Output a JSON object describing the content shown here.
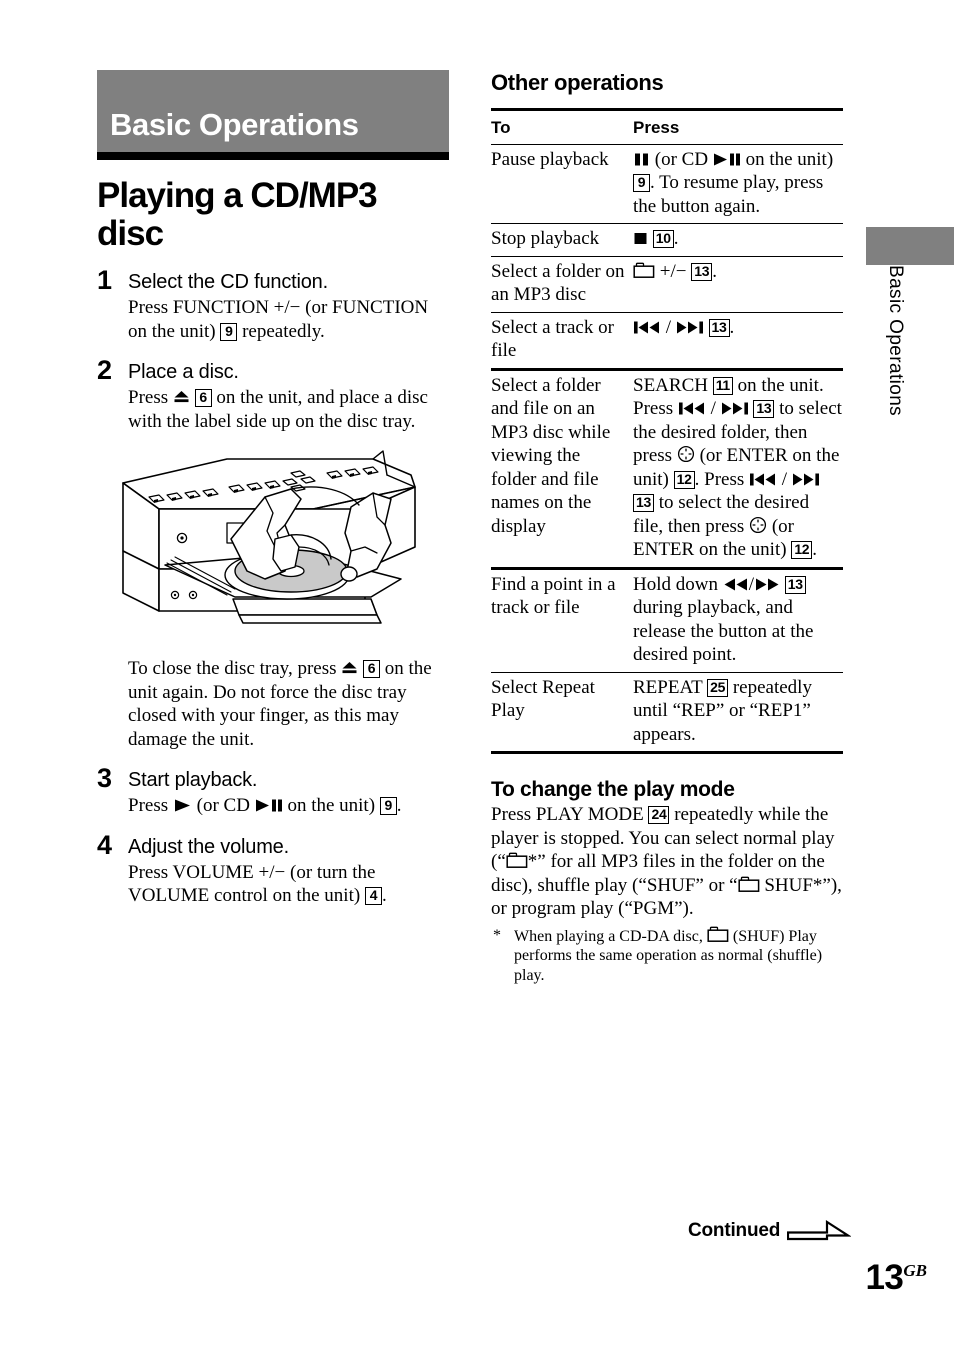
{
  "chapter": {
    "banner_label": "Basic Operations",
    "side_tab_label": "Basic Operations",
    "banner_color": "#808080"
  },
  "page_title": "Playing a CD/MP3 disc",
  "steps": [
    {
      "num": "1",
      "title": "Select the CD function.",
      "body_pre": "Press FUNCTION +/− (or FUNCTION on the unit) ",
      "ref": "9",
      "body_post": " repeatedly."
    },
    {
      "num": "2",
      "title": "Place a disc.",
      "body_pre": "Press ",
      "ref": "6",
      "body_post": " on the unit, and place a disc with the label side up on the disc tray."
    },
    {
      "num": "3",
      "title": "Start playback.",
      "body_pre": "Press ",
      "body_mid": " (or CD ",
      "ref": "9",
      "body_post": " on the unit) "
    },
    {
      "num": "4",
      "title": "Adjust the volume.",
      "body_pre": "Press VOLUME +/− (or turn the VOLUME control on the unit) ",
      "ref": "4",
      "body_post": "."
    }
  ],
  "illustration": {
    "name": "cd-player-loading-disc",
    "caption": ""
  },
  "tray_note": {
    "line1_pre": "To close the disc tray, press ",
    "line1_ref": "6",
    "line1_post": " on the unit again.",
    "line2": "Do not force the disc tray closed with your finger, as this may damage the unit."
  },
  "other_operations": {
    "heading": "Other operations",
    "columns": [
      "To",
      "Press"
    ],
    "rows": [
      {
        "to": "Pause playback",
        "press_parts": [
          {
            "type": "icon",
            "name": "pause-icon"
          },
          {
            "type": "text",
            "value": " (or CD "
          },
          {
            "type": "icon",
            "name": "play-pause-icon"
          },
          {
            "type": "text",
            "value": " on the unit) "
          },
          {
            "type": "ref",
            "value": "9"
          },
          {
            "type": "text",
            "value": ". To resume play, press the button again."
          }
        ]
      },
      {
        "to": "Stop playback",
        "press_parts": [
          {
            "type": "icon",
            "name": "stop-icon"
          },
          {
            "type": "text",
            "value": " "
          },
          {
            "type": "ref",
            "value": "10"
          },
          {
            "type": "text",
            "value": "."
          }
        ]
      },
      {
        "to": "Select a folder on an MP3 disc",
        "press_parts": [
          {
            "type": "icon",
            "name": "folder-icon"
          },
          {
            "type": "text",
            "value": " +/− "
          },
          {
            "type": "ref",
            "value": "13"
          },
          {
            "type": "text",
            "value": "."
          }
        ]
      },
      {
        "to": "Select a track or file",
        "press_parts": [
          {
            "type": "icon",
            "name": "prev-track-icon"
          },
          {
            "type": "text",
            "value": " / "
          },
          {
            "type": "icon",
            "name": "next-track-icon"
          },
          {
            "type": "text",
            "value": " "
          },
          {
            "type": "ref",
            "value": "13"
          },
          {
            "type": "text",
            "value": "."
          }
        ]
      },
      {
        "to": "Select a folder and file on an MP3 disc while viewing the folder and file names on the display",
        "press_parts": [
          {
            "type": "text",
            "value": "SEARCH "
          },
          {
            "type": "ref",
            "value": "11"
          },
          {
            "type": "text",
            "value": " on the unit. Press "
          },
          {
            "type": "icon",
            "name": "prev-track-icon"
          },
          {
            "type": "text",
            "value": " / "
          },
          {
            "type": "icon",
            "name": "next-track-icon"
          },
          {
            "type": "text",
            "value": " "
          },
          {
            "type": "ref",
            "value": "13"
          },
          {
            "type": "text",
            "value": " to select the desired folder, then press "
          },
          {
            "type": "icon",
            "name": "enter-circle-icon"
          },
          {
            "type": "text",
            "value": " (or ENTER on the unit) "
          },
          {
            "type": "ref",
            "value": "12"
          },
          {
            "type": "text",
            "value": ". Press "
          },
          {
            "type": "icon",
            "name": "prev-track-icon"
          },
          {
            "type": "text",
            "value": " / "
          },
          {
            "type": "icon",
            "name": "next-track-icon"
          },
          {
            "type": "text",
            "value": " "
          },
          {
            "type": "ref",
            "value": "13"
          },
          {
            "type": "text",
            "value": " to select the desired file, then press "
          },
          {
            "type": "icon",
            "name": "enter-circle-icon"
          },
          {
            "type": "text",
            "value": " (or ENTER on the unit) "
          },
          {
            "type": "ref",
            "value": "12"
          },
          {
            "type": "text",
            "value": "."
          }
        ]
      },
      {
        "to": "Find a point in a track or file",
        "press_parts": [
          {
            "type": "text",
            "value": "Hold down "
          },
          {
            "type": "icon",
            "name": "rewind-icon"
          },
          {
            "type": "text",
            "value": "/"
          },
          {
            "type": "icon",
            "name": "fast-forward-icon"
          },
          {
            "type": "text",
            "value": " "
          },
          {
            "type": "ref",
            "value": "13"
          },
          {
            "type": "text",
            "value": " during playback, and release the button at the desired point."
          }
        ]
      },
      {
        "to": "Select Repeat Play",
        "press_parts": [
          {
            "type": "text",
            "value": "REPEAT "
          },
          {
            "type": "ref",
            "value": "25"
          },
          {
            "type": "text",
            "value": " repeatedly until “REP” or “REP1” appears."
          }
        ]
      }
    ]
  },
  "play_mode": {
    "heading": "To change the play mode",
    "body_parts": [
      {
        "type": "text",
        "value": "Press PLAY MODE "
      },
      {
        "type": "ref",
        "value": "24"
      },
      {
        "type": "text",
        "value": " repeatedly while the player is stopped. You can select normal play (“"
      },
      {
        "type": "icon",
        "name": "folder-icon"
      },
      {
        "type": "text",
        "value": "*” for all MP3 files in the folder on the disc), shuffle play (“SHUF” or “"
      },
      {
        "type": "icon",
        "name": "folder-icon"
      },
      {
        "type": "text",
        "value": " SHUF*”), or program play (“PGM”)."
      }
    ],
    "footnote_marker": "*",
    "footnote_parts": [
      {
        "type": "text",
        "value": "When playing a CD-DA disc, "
      },
      {
        "type": "icon",
        "name": "folder-icon"
      },
      {
        "type": "text",
        "value": " (SHUF) Play performs the same operation as normal (shuffle) play."
      }
    ]
  },
  "footer": {
    "continued_label": "Continued",
    "continued_icon": "arrow-right-outline-icon",
    "page_number": "13",
    "page_suffix": "GB"
  }
}
